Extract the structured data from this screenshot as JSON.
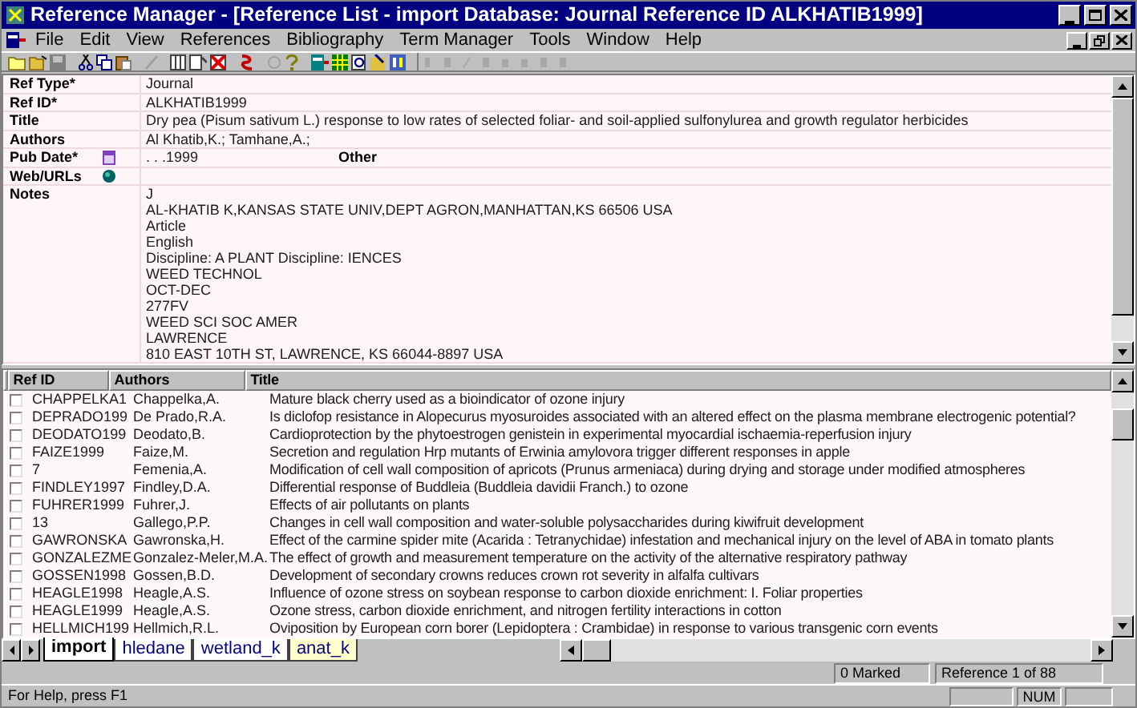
{
  "window": {
    "title": "Reference Manager - [Reference List - import Database: Journal Reference ID ALKHATIB1999]"
  },
  "menu": [
    "File",
    "Edit",
    "View",
    "References",
    "Bibliography",
    "Term Manager",
    "Tools",
    "Window",
    "Help"
  ],
  "detail": {
    "fields": [
      {
        "label": "Ref Type*",
        "value": "Journal"
      },
      {
        "label": "Ref ID*",
        "value": "ALKHATIB1999"
      },
      {
        "label": "Title",
        "value": "Dry pea (Pisum sativum L.) response to low rates of selected foliar- and soil-applied sulfonylurea and growth regulator herbicides"
      },
      {
        "label": "Authors",
        "value": "Al Khatib,K.; Tamhane,A.;"
      },
      {
        "label": "Pub Date*",
        "value": ". . .1999",
        "extra": "Other"
      },
      {
        "label": "Web/URLs"
      },
      {
        "label": "Notes",
        "lines": [
          "J",
          "AL-KHATIB K,KANSAS STATE UNIV,DEPT AGRON,MANHATTAN,KS 66506 USA",
          "Article",
          "English",
          "Discipline: A PLANT Discipline: IENCES",
          "WEED TECHNOL",
          "OCT-DEC",
          "277FV",
          "WEED SCI SOC AMER",
          "LAWRENCE",
          "810 EAST 10TH ST, LAWRENCE, KS 66044-8897 USA"
        ]
      }
    ]
  },
  "table": {
    "columns": [
      "Ref ID",
      "Authors",
      "Title"
    ],
    "rows": [
      {
        "checked": false,
        "cells": [
          "CHAPPELKA1",
          "Chappelka,A.",
          "Mature black cherry used as a bioindicator of ozone injury"
        ]
      },
      {
        "checked": false,
        "cells": [
          "DEPRADO199",
          "De Prado,R.A.",
          "Is diclofop resistance in Alopecurus myosuroides associated with an altered effect on the plasma membrane electrogenic potential?"
        ]
      },
      {
        "checked": false,
        "cells": [
          "DEODATO199",
          "Deodato,B.",
          "Cardioprotection by the phytoestrogen genistein in experimental myocardial ischaemia-reperfusion injury"
        ]
      },
      {
        "checked": false,
        "cells": [
          "FAIZE1999",
          "Faize,M.",
          "Secretion and regulation Hrp mutants of Erwinia amylovora trigger different responses in apple"
        ]
      },
      {
        "checked": false,
        "cells": [
          "7",
          "Femenia,A.",
          "Modification of cell wall composition of apricots (Prunus armeniaca) during drying and storage under modified atmospheres"
        ]
      },
      {
        "checked": false,
        "cells": [
          "FINDLEY1997",
          "Findley,D.A.",
          "Differential response of Buddleia (Buddleia davidii Franch.) to ozone"
        ]
      },
      {
        "checked": false,
        "cells": [
          "FUHRER1999",
          "Fuhrer,J.",
          "Effects of air pollutants on plants"
        ]
      },
      {
        "checked": false,
        "cells": [
          "13",
          "Gallego,P.P.",
          "Changes in cell wall composition and water-soluble polysaccharides during kiwifruit development"
        ]
      },
      {
        "checked": false,
        "cells": [
          "GAWRONSKA",
          "Gawronska,H.",
          "Effect of the carmine spider mite (Acarida : Tetranychidae) infestation and mechanical injury on the level of ABA in tomato plants"
        ]
      },
      {
        "checked": false,
        "cells": [
          "GONZALEZME",
          "Gonzalez-Meler,M.A.",
          "The effect of growth and measurement temperature on the activity of the alternative respiratory pathway"
        ]
      },
      {
        "checked": false,
        "cells": [
          "GOSSEN1998",
          "Gossen,B.D.",
          "Development of secondary crowns reduces crown rot severity in alfalfa cultivars"
        ]
      },
      {
        "checked": false,
        "cells": [
          "HEAGLE1998",
          "Heagle,A.S.",
          "Influence of ozone stress on soybean response to carbon dioxide enrichment: I. Foliar properties"
        ]
      },
      {
        "checked": false,
        "cells": [
          "HEAGLE1999",
          "Heagle,A.S.",
          "Ozone stress, carbon dioxide enrichment, and nitrogen fertility interactions in cotton"
        ]
      },
      {
        "checked": false,
        "cells": [
          "HELLMICH199",
          "Hellmich,R.L.",
          "Oviposition by European corn borer (Lepidoptera : Crambidae) in response to various transgenic corn events"
        ]
      }
    ]
  },
  "tabs": [
    {
      "label": "import",
      "selected": true,
      "color": "#ffffff"
    },
    {
      "label": "hledane",
      "selected": false,
      "color": "#ffffff"
    },
    {
      "label": "wetland_k",
      "selected": false,
      "color": "#ffffff"
    },
    {
      "label": "anat_k",
      "selected": false,
      "color": "#ffffcc"
    }
  ],
  "status_bar": {
    "marked": "0 Marked",
    "position": "Reference 1 of 88",
    "help": "For Help, press F1",
    "num": "NUM"
  }
}
